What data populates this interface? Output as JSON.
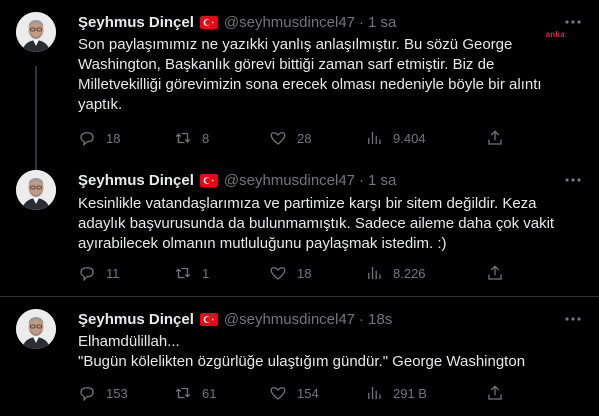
{
  "tweets": [
    {
      "author_name": "Şeyhmus Dinçel",
      "handle": "@seyhmusdincel47",
      "time": "1 sa",
      "text": "Son paylaşımımız ne yazıkki yanlış anlaşılmıştır. Bu sözü George Washington, Başkanlık görevi bittiği zaman sarf etmiştir. Biz de Milletvekilliği görevimizin sona erecek olması nedeniyle böyle bir alıntı yaptık.",
      "replies": "18",
      "retweets": "8",
      "likes": "28",
      "views": "9.404",
      "watermark": "anka"
    },
    {
      "author_name": "Şeyhmus Dinçel",
      "handle": "@seyhmusdincel47",
      "time": "1 sa",
      "text": "Kesinlikle vatandaşlarımıza ve partimize karşı bir sitem değildir. Keza adaylık başvurusunda da bulunmamıştık. Sadece aileme daha çok vakit ayırabilecek olmanın mutluluğunu paylaşmak istedim. :)",
      "replies": "11",
      "retweets": "1",
      "likes": "18",
      "views": "8.226"
    },
    {
      "author_name": "Şeyhmus Dinçel",
      "handle": "@seyhmusdincel47",
      "time": "18s",
      "text": "Elhamdülillah...\n\"Bugün kölelikten özgürlüğe ulaştığım gündür.\"   George Washington",
      "replies": "153",
      "retweets": "61",
      "likes": "154",
      "views": "291 B"
    }
  ],
  "colors": {
    "background": "#000000",
    "text": "#e7e9ea",
    "muted": "#71767b",
    "divider": "#2f3336",
    "flag_red": "#e30a17"
  },
  "icons": [
    "more-icon",
    "reply-icon",
    "retweet-icon",
    "like-icon",
    "views-icon",
    "share-icon",
    "turkish-flag-icon"
  ]
}
